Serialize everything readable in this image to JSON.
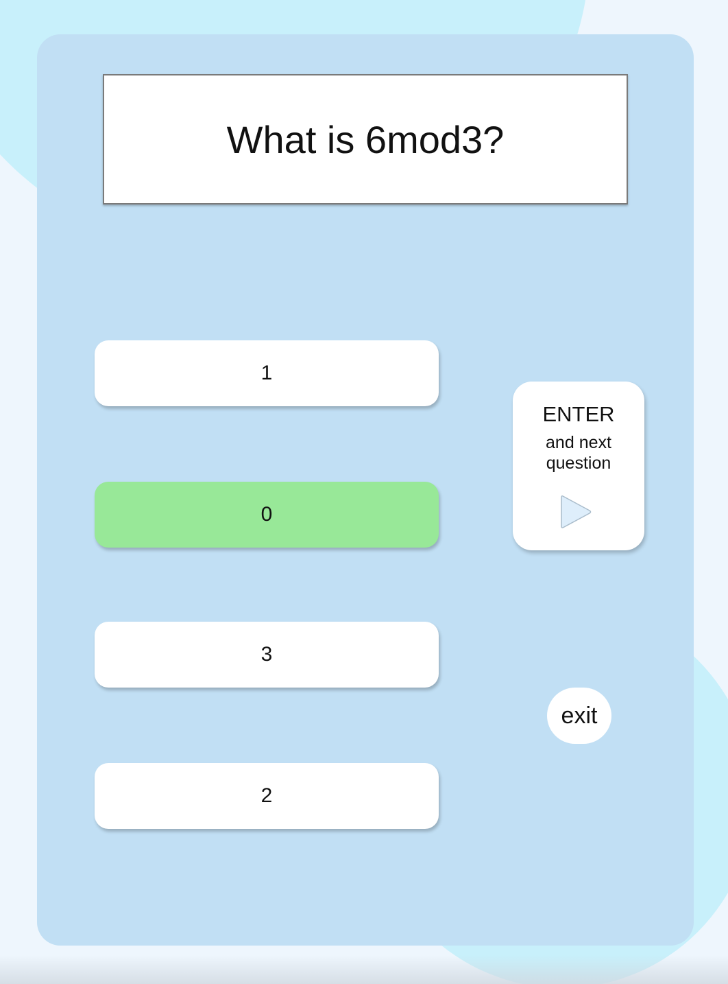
{
  "colors": {
    "page_background": "#eef6fd",
    "blob": "#c8f0fb",
    "card": "#c1dff4",
    "selected_answer": "#98e898",
    "button": "#ffffff"
  },
  "question": {
    "text": "What is 6mod3?"
  },
  "answers": [
    {
      "label": "1",
      "selected": false
    },
    {
      "label": "0",
      "selected": true
    },
    {
      "label": "3",
      "selected": false
    },
    {
      "label": "2",
      "selected": false
    }
  ],
  "enter_button": {
    "title": "ENTER",
    "subtitle_line1": "and next",
    "subtitle_line2": "question",
    "icon": "play-icon"
  },
  "exit_button": {
    "label": "exit"
  }
}
